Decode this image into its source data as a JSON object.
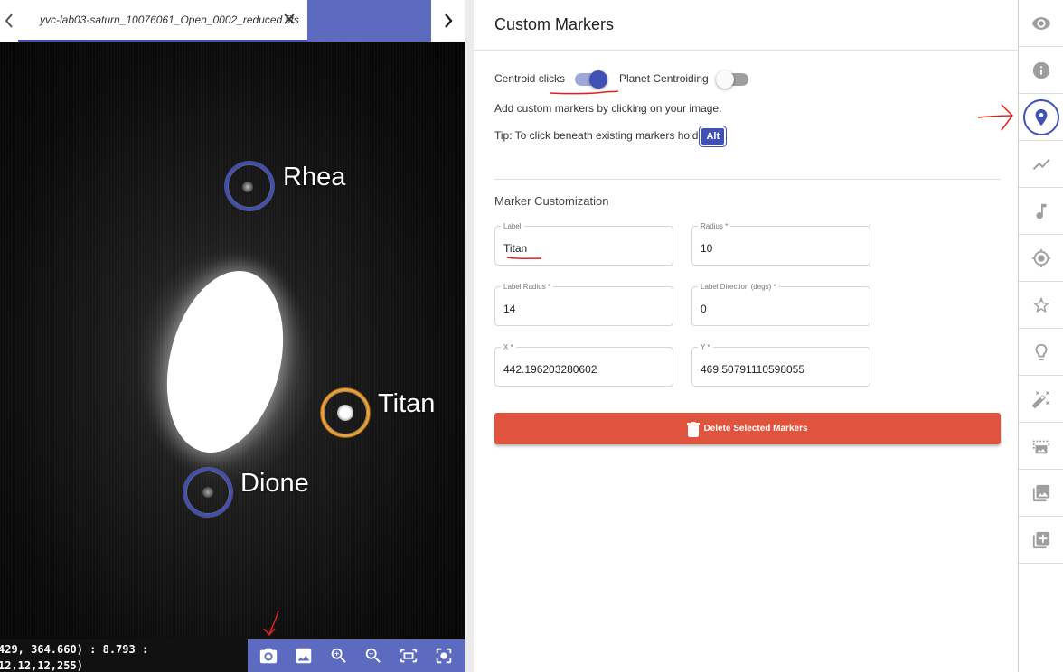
{
  "tabs": {
    "active_label": "yvc-lab03-saturn_10076061_Open_0002_reduced.fits",
    "prev_icon": "chevron-left-icon",
    "next_icon": "chevron-right-icon",
    "close_icon": "close-icon"
  },
  "image": {
    "markers": [
      {
        "label": "Rhea",
        "selected": false
      },
      {
        "label": "Titan",
        "selected": true
      },
      {
        "label": "Dione",
        "selected": false
      }
    ]
  },
  "status": {
    "line1": "429, 364.660) : 8.793 :",
    "line2": "12,12,12,255)"
  },
  "image_toolbar": {
    "buttons": [
      "camera-icon",
      "image-icon",
      "zoom-in-icon",
      "zoom-out-icon",
      "fit-screen-icon",
      "center-focus-icon"
    ]
  },
  "panel": {
    "title": "Custom Markers",
    "centroid_clicks_label": "Centroid clicks",
    "centroid_clicks_on": true,
    "planet_centroiding_label": "Planet Centroiding",
    "planet_centroiding_on": false,
    "instructions": "Add custom markers by clicking on your image.",
    "tip": "Tip: To click beneath existing markers hold",
    "tip_key": "Alt",
    "section_title": "Marker Customization",
    "fields": {
      "label": {
        "label": "Label",
        "value": "Titan"
      },
      "radius": {
        "label": "Radius *",
        "value": "10"
      },
      "label_radius": {
        "label": "Label Radius *",
        "value": "14"
      },
      "label_direction": {
        "label": "Label Direction (degs) *",
        "value": "0"
      },
      "x": {
        "label": "X *",
        "value": "442.196203280602"
      },
      "y": {
        "label": "Y *",
        "value": "469.50791110598055"
      }
    },
    "delete_button": "Delete Selected Markers",
    "delete_icon": "trash-icon"
  },
  "sidebar": {
    "items": [
      {
        "icon": "eye-icon",
        "active": false
      },
      {
        "icon": "info-icon",
        "active": false
      },
      {
        "icon": "location-pin-icon",
        "active": true
      },
      {
        "icon": "trending-icon",
        "active": false
      },
      {
        "icon": "music-note-icon",
        "active": false
      },
      {
        "icon": "target-icon",
        "active": false
      },
      {
        "icon": "star-icon",
        "active": false
      },
      {
        "icon": "lightbulb-icon",
        "active": false
      },
      {
        "icon": "magic-wand-icon",
        "active": false
      },
      {
        "icon": "image-select-icon",
        "active": false
      },
      {
        "icon": "photo-library-icon",
        "active": false
      },
      {
        "icon": "add-layer-icon",
        "active": false
      }
    ]
  },
  "colors": {
    "accent": "#3f51b5",
    "toolbar": "#5c6bc0",
    "danger": "#e0533c",
    "selected_marker": "#f0a030",
    "annotation": "#e02020"
  }
}
